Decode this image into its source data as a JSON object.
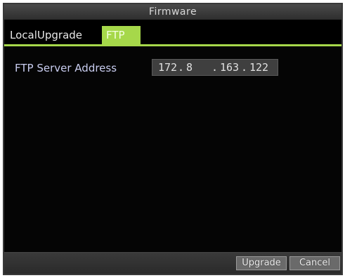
{
  "window": {
    "title": "Firmware"
  },
  "tabs": [
    {
      "label": "LocalUpgrade",
      "active": false
    },
    {
      "label": "FTP",
      "active": true
    }
  ],
  "ftp": {
    "server_address_label": "FTP Server Address",
    "ip": [
      "172",
      "8",
      "163",
      "122"
    ],
    "ip_separator": "."
  },
  "buttons": {
    "upgrade_label": "Upgrade",
    "cancel_label": "Cancel"
  },
  "colors": {
    "accent": "#a6d84a",
    "background": "#050505",
    "label": "#c9cdf0"
  }
}
